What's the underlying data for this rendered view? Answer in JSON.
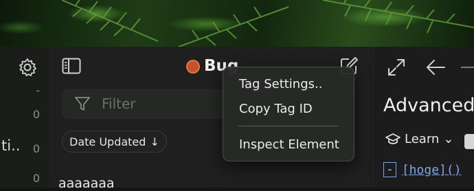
{
  "wallpaper": {
    "icon": "fern-wallpaper"
  },
  "left_column": {
    "settings_icon": "gear-icon",
    "counts": [
      "-",
      "0",
      "0",
      "0",
      "0"
    ],
    "truncated_label": "ti.."
  },
  "note_list": {
    "sidebar_icon": "sidebar-toggle-icon",
    "tag": {
      "title": "Bug",
      "color": "#c7512a"
    },
    "compose_icon": "compose-icon",
    "filter": {
      "placeholder": "Filter"
    },
    "sort": {
      "label": "Date Updated",
      "direction_glyph": "↓"
    },
    "items": [
      {
        "title": "aaaaaaa"
      }
    ]
  },
  "context_menu": {
    "items": [
      {
        "label": "Tag Settings.."
      },
      {
        "label": "Copy Tag ID"
      },
      {
        "label": "Inspect Element"
      }
    ]
  },
  "editor": {
    "expand_icon": "expand-icon",
    "back_icon": "arrow-left-icon",
    "title": "Advanced",
    "learn": {
      "label": "Learn",
      "chevron": "⌄"
    },
    "code": {
      "minus": "-",
      "link_text": "[hoge]()"
    }
  }
}
